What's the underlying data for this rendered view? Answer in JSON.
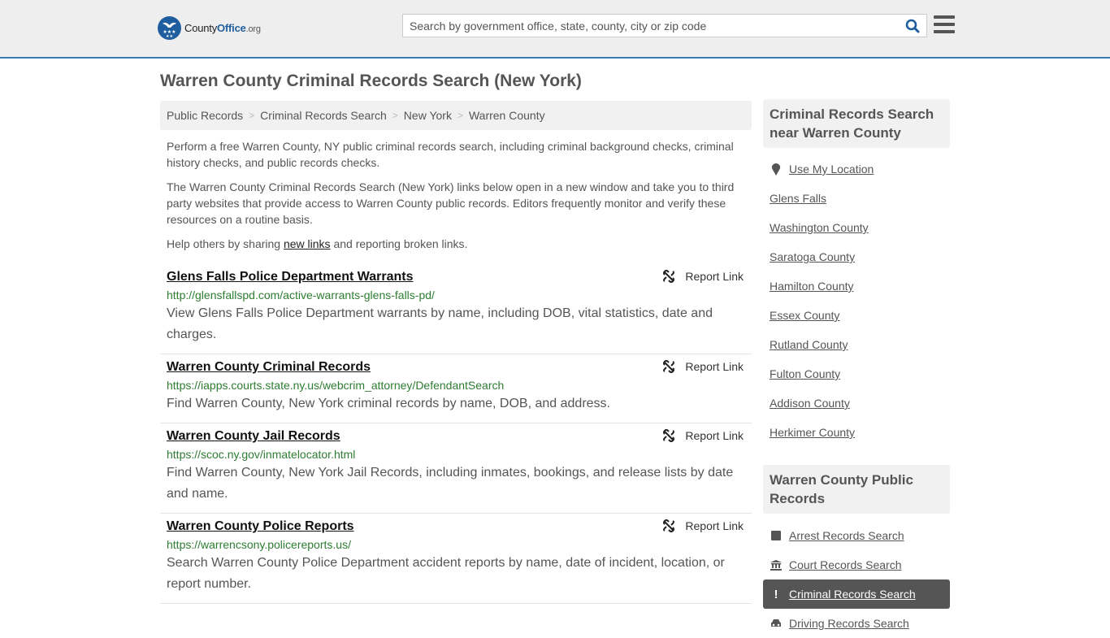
{
  "header": {
    "logo": {
      "name_part1": "County",
      "name_part2": "Office",
      "name_part3": ".org"
    },
    "search": {
      "placeholder": "Search by government office, state, county, city or zip code",
      "value": ""
    },
    "icons": {
      "search": "search-icon",
      "menu": "hamburger-menu-icon"
    }
  },
  "page": {
    "title": "Warren County Criminal Records Search (New York)"
  },
  "breadcrumb": [
    {
      "label": "Public Records"
    },
    {
      "label": "Criminal Records Search"
    },
    {
      "label": "New York"
    },
    {
      "label": "Warren County"
    }
  ],
  "intro": {
    "p1": "Perform a free Warren County, NY public criminal records search, including criminal background checks, criminal history checks, and public records checks.",
    "p2": "The Warren County Criminal Records Search (New York) links below open in a new window and take you to third party websites that provide access to Warren County public records. Editors frequently monitor and verify these resources on a routine basis.",
    "p3_before": "Help others by sharing ",
    "p3_link": "new links",
    "p3_after": " and reporting broken links."
  },
  "results": [
    {
      "title": "Glens Falls Police Department Warrants",
      "url": "http://glensfallspd.com/active-warrants-glens-falls-pd/",
      "description": "View Glens Falls Police Department warrants by name, including DOB, vital statistics, date and charges.",
      "report_label": "Report Link"
    },
    {
      "title": "Warren County Criminal Records",
      "url": "https://iapps.courts.state.ny.us/webcrim_attorney/DefendantSearch",
      "description": "Find Warren County, New York criminal records by name, DOB, and address.",
      "report_label": "Report Link"
    },
    {
      "title": "Warren County Jail Records",
      "url": "https://scoc.ny.gov/inmatelocator.html",
      "description": "Find Warren County, New York Jail Records, including inmates, bookings, and release lists by date and name.",
      "report_label": "Report Link"
    },
    {
      "title": "Warren County Police Reports",
      "url": "https://warrencsony.policereports.us/",
      "description": "Search Warren County Police Department accident reports by name, date of incident, location, or report number.",
      "report_label": "Report Link"
    }
  ],
  "sidebar": {
    "nearby": {
      "heading": "Criminal Records Search near Warren County",
      "use_location": "Use My Location",
      "items": [
        {
          "label": "Glens Falls"
        },
        {
          "label": "Washington County"
        },
        {
          "label": "Saratoga County"
        },
        {
          "label": "Hamilton County"
        },
        {
          "label": "Essex County"
        },
        {
          "label": "Rutland County"
        },
        {
          "label": "Fulton County"
        },
        {
          "label": "Addison County"
        },
        {
          "label": "Herkimer County"
        }
      ]
    },
    "public_records": {
      "heading": "Warren County Public Records",
      "items": [
        {
          "label": "Arrest Records Search",
          "icon": "square-icon",
          "active": false
        },
        {
          "label": "Court Records Search",
          "icon": "courthouse-icon",
          "active": false
        },
        {
          "label": "Criminal Records Search",
          "icon": "exclamation-icon",
          "active": true
        },
        {
          "label": "Driving Records Search",
          "icon": "car-icon",
          "active": false
        }
      ]
    }
  }
}
